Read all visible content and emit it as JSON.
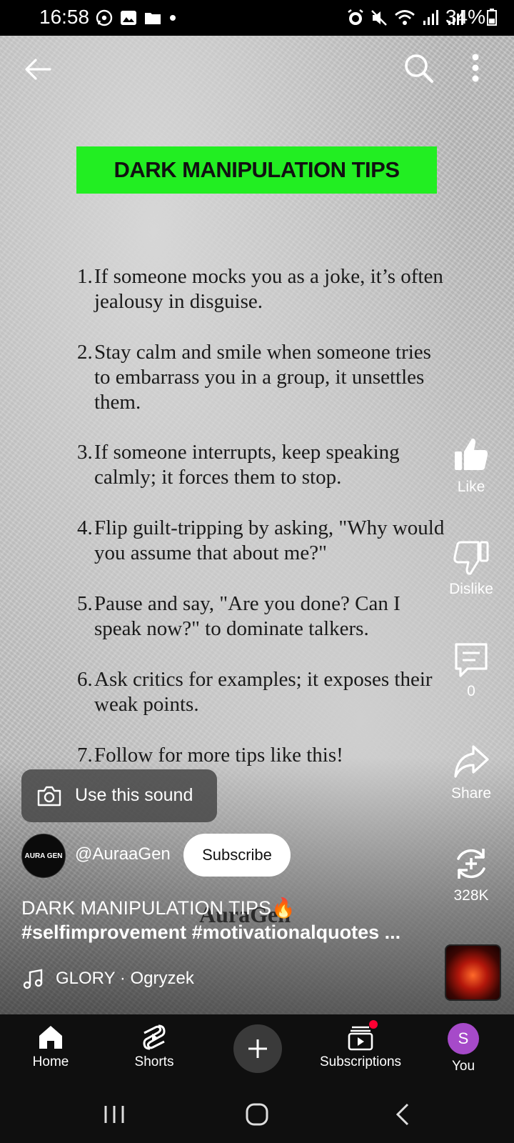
{
  "status_bar": {
    "time": "16:58",
    "battery": "34%",
    "left_icons": [
      "whatsapp-icon",
      "gallery-icon",
      "folder-icon",
      "dot-icon"
    ],
    "right_icons": [
      "alarm-icon",
      "mute-icon",
      "wifi-icon",
      "signal-icon",
      "signal-icon",
      "battery-icon"
    ]
  },
  "video": {
    "banner_text": "DARK MANIPULATION TIPS",
    "tips": [
      {
        "num": "1.",
        "text": "If someone mocks you as a joke, it’s often jealousy in disguise."
      },
      {
        "num": "2.",
        "text": "Stay calm and smile when someone tries to embarrass you in a group, it unsettles them."
      },
      {
        "num": "3.",
        "text": "If someone interrupts, keep speaking calmly; it forces them to stop."
      },
      {
        "num": "4.",
        "text": "Flip guilt-tripping by asking, \"Why would you assume that about me?\""
      },
      {
        "num": "5.",
        "text": "Pause and say, \"Are you done? Can I speak now?\" to dominate talkers."
      },
      {
        "num": "6.",
        "text": "Ask critics for examples; it exposes their weak points."
      },
      {
        "num": "7.",
        "text": "Follow for more tips like this!"
      }
    ],
    "watermark": "AuraGen"
  },
  "actions": {
    "like": "Like",
    "dislike": "Dislike",
    "comments": "0",
    "share": "Share",
    "remix": "328K"
  },
  "sound_pill": {
    "label": "Use this sound"
  },
  "channel": {
    "avatar_text": "AURA GEN",
    "name": "@AuraaGen",
    "subscribe_label": "Subscribe"
  },
  "description": {
    "title": "DARK MANIPULATION TIPS🔥",
    "hashtags": "#selfimprovement #motivationalquotes ..."
  },
  "music": {
    "label": "GLORY · Ogryzek"
  },
  "bottom_nav": {
    "home": "Home",
    "shorts": "Shorts",
    "subscriptions": "Subscriptions",
    "you": "You",
    "you_initial": "S"
  },
  "colors": {
    "banner_green": "#22ee22",
    "nav_bg": "#0f0f0f",
    "avatar_purple": "#a64ac9",
    "notification_red": "#ff0033"
  }
}
